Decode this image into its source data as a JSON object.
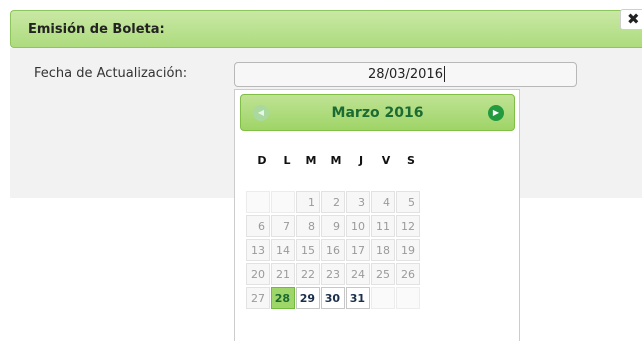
{
  "dialog": {
    "title": "Emisión de Boleta:",
    "close_label": "✖"
  },
  "form": {
    "date_label": "Fecha de Actualización:",
    "date_value": "28/03/2016"
  },
  "datepicker": {
    "month_year": "Marzo 2016",
    "prev_label": "◀",
    "next_label": "▶",
    "weekdays": [
      "D",
      "L",
      "M",
      "M",
      "J",
      "V",
      "S"
    ],
    "weeks": [
      [
        "",
        "",
        "1",
        "2",
        "3",
        "4",
        "5"
      ],
      [
        "6",
        "7",
        "8",
        "9",
        "10",
        "11",
        "12"
      ],
      [
        "13",
        "14",
        "15",
        "16",
        "17",
        "18",
        "19"
      ],
      [
        "20",
        "21",
        "22",
        "23",
        "24",
        "25",
        "26"
      ],
      [
        "27",
        "28",
        "29",
        "30",
        "31",
        "",
        ""
      ]
    ],
    "selected_day": "28",
    "enabled_days": [
      "28",
      "29",
      "30",
      "31"
    ]
  },
  "colors": {
    "header_green": "#addb7e",
    "selected_day_bg": "#9ed66a",
    "next_button": "#239a40"
  }
}
